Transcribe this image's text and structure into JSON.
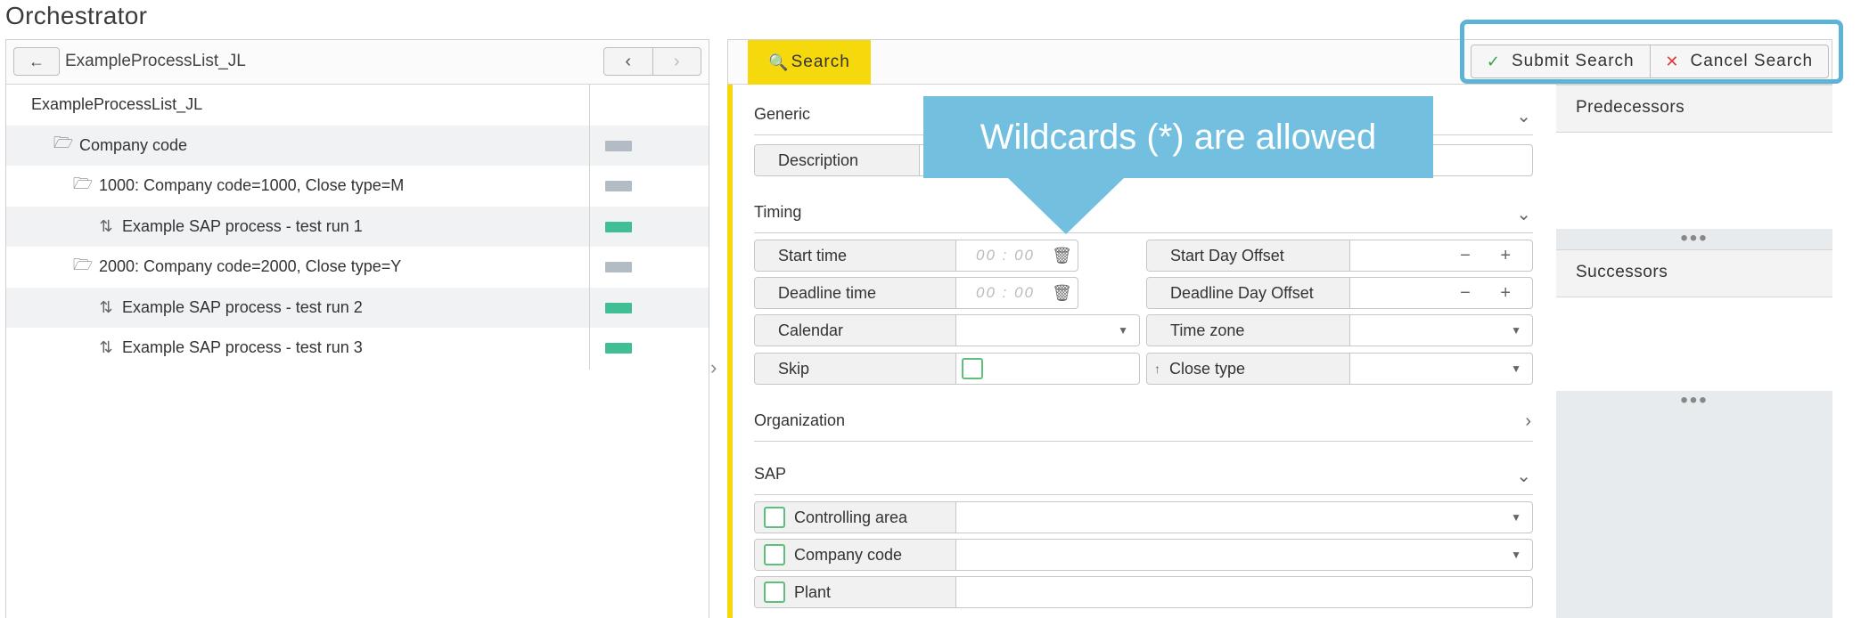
{
  "app": {
    "title": "Orchestrator"
  },
  "left": {
    "back_label": "←",
    "list_name": "ExampleProcessList_JL",
    "prev_label": "‹",
    "next_label": "›",
    "tree": [
      {
        "label": "ExampleProcessList_JL",
        "level": 0,
        "icon": "",
        "status": ""
      },
      {
        "label": "Company code",
        "level": 1,
        "icon": "🗁",
        "status": "grey"
      },
      {
        "label": "1000: Company code=1000, Close type=M",
        "level": 2,
        "icon": "🗁",
        "status": "grey"
      },
      {
        "label": "Example SAP process - test run 1",
        "level": 3,
        "icon": "⇅",
        "status": "green"
      },
      {
        "label": "2000: Company code=2000, Close type=Y",
        "level": 2,
        "icon": "🗁",
        "status": "grey"
      },
      {
        "label": "Example SAP process - test run 2",
        "level": 3,
        "icon": "⇅",
        "status": "green"
      },
      {
        "label": "Example SAP process - test run 3",
        "level": 3,
        "icon": "⇅",
        "status": "green"
      }
    ],
    "collapse_label": "›"
  },
  "right": {
    "search_tab": "Search",
    "submit_label": "Submit Search",
    "cancel_label": "Cancel Search",
    "sections": {
      "generic": "Generic",
      "timing": "Timing",
      "organization": "Organization",
      "sap": "SAP"
    },
    "fields": {
      "description": "Description",
      "start_time": "Start time",
      "deadline_time": "Deadline time",
      "time_placeholder": "00 : 00",
      "calendar": "Calendar",
      "skip": "Skip",
      "start_day_offset": "Start Day Offset",
      "deadline_day_offset": "Deadline Day Offset",
      "time_zone": "Time zone",
      "close_type": "Close type",
      "controlling_area": "Controlling area",
      "company_code": "Company code",
      "plant": "Plant"
    },
    "stepper": "− +",
    "caret": "▼",
    "sort_icon": "↑",
    "chevron_down": "⌄",
    "chevron_right": "›"
  },
  "side": {
    "predecessors": "Predecessors",
    "successors": "Successors",
    "dots": "•••"
  },
  "callout": {
    "text": "Wildcards (*) are allowed"
  },
  "colors": {
    "accent": "#f5d90c",
    "highlight": "#5cb3d6",
    "callout": "#72bfe0",
    "status_green": "#3fbf93",
    "status_grey": "#b3bcc5"
  }
}
